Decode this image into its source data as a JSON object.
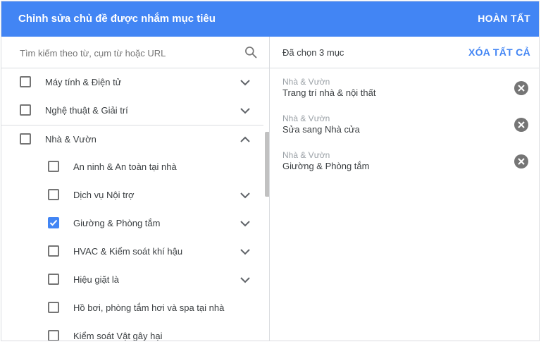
{
  "header": {
    "title": "Chỉnh sửa chủ đề được nhắm mục tiêu",
    "done_label": "HOÀN TẤT"
  },
  "search": {
    "placeholder": "Tìm kiếm theo từ, cụm từ hoặc URL",
    "icon": "search-icon"
  },
  "categories": [
    {
      "label": "Máy tính & Điện tử",
      "checked": false,
      "expand": "chevron-down"
    },
    {
      "label": "Nghệ thuật & Giải trí",
      "checked": false,
      "expand": "chevron-down"
    },
    {
      "label": "Nhà & Vườn",
      "checked": false,
      "expand": "chevron-up"
    }
  ],
  "subcategories": [
    {
      "label": "An ninh & An toàn tại nhà",
      "checked": false,
      "expand": ""
    },
    {
      "label": "Dịch vụ Nội trợ",
      "checked": false,
      "expand": "chevron-down"
    },
    {
      "label": "Giường & Phòng tắm",
      "checked": true,
      "expand": "chevron-down"
    },
    {
      "label": "HVAC & Kiểm soát khí hậu",
      "checked": false,
      "expand": "chevron-down"
    },
    {
      "label": "Hiệu giặt là",
      "checked": false,
      "expand": "chevron-down"
    },
    {
      "label": "Hồ bơi, phòng tắm hơi và spa tại nhà",
      "checked": false,
      "expand": ""
    },
    {
      "label": "Kiểm soát Vật gây hại",
      "checked": false,
      "expand": ""
    }
  ],
  "selected_panel": {
    "count_label": "Đã chọn 3 mục",
    "clear_all_label": "XÓA TẤT CẢ",
    "items": [
      {
        "category": "Nhà & Vườn",
        "name": "Trang trí nhà & nội thất"
      },
      {
        "category": "Nhà & Vườn",
        "name": "Sửa sang Nhà cửa"
      },
      {
        "category": "Nhà & Vườn",
        "name": "Giường & Phòng tắm"
      }
    ]
  },
  "colors": {
    "accent": "#4285f4",
    "header_bg": "#4285f4"
  }
}
